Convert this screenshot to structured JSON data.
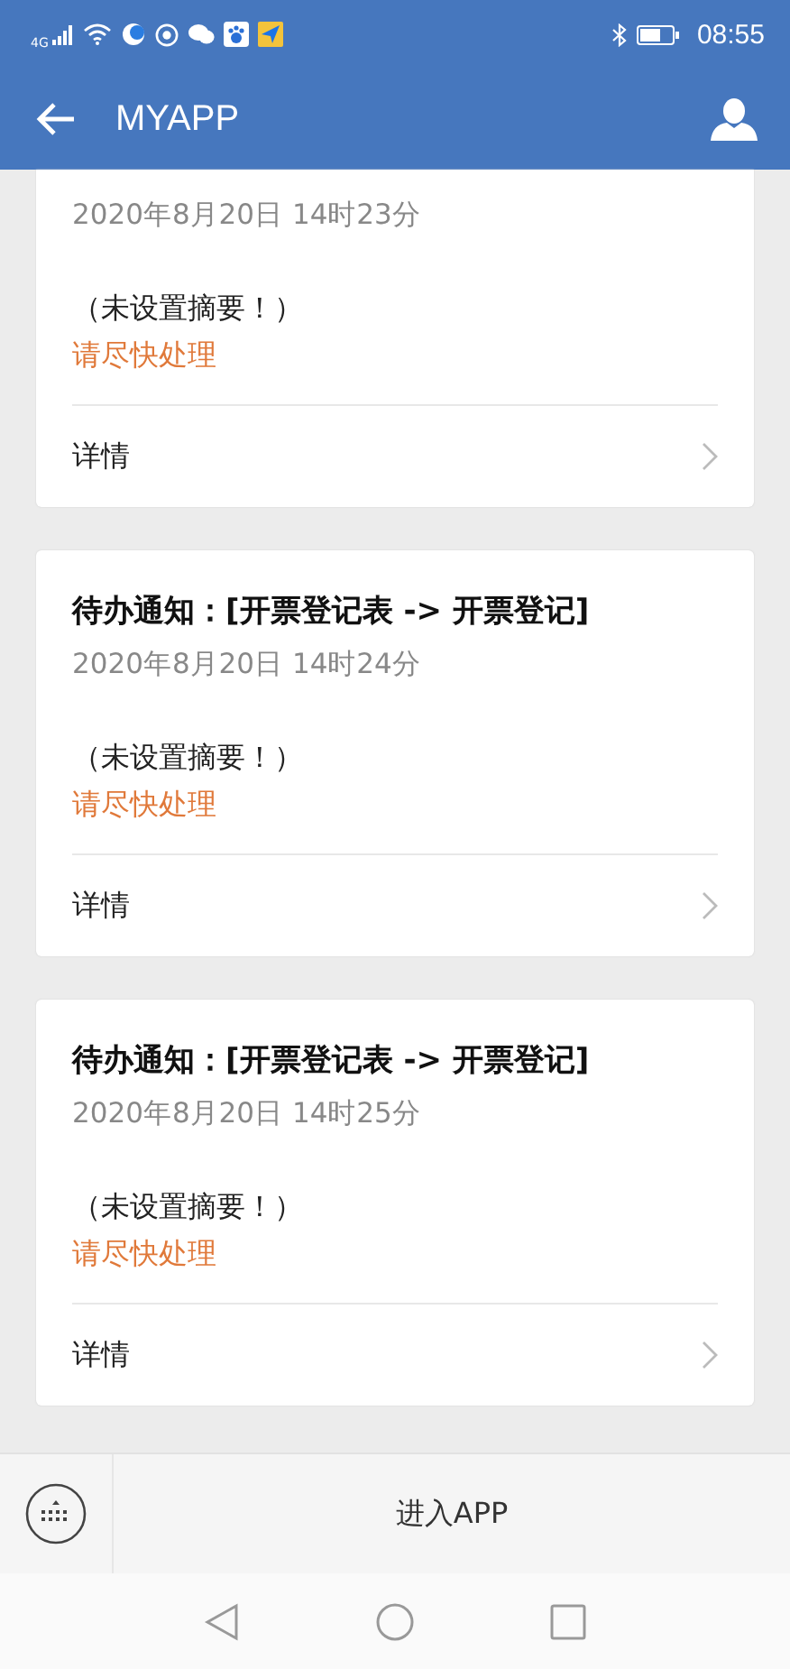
{
  "status_bar": {
    "network": "4G",
    "time": "08:55"
  },
  "header": {
    "title": "MYAPP"
  },
  "cards": [
    {
      "date": "2020年8月20日 14时23分",
      "summary": "（未设置摘要！）",
      "urgent": "请尽快处理",
      "detail": "详情"
    },
    {
      "title": "待办通知：[开票登记表 -> 开票登记]",
      "date": "2020年8月20日 14时24分",
      "summary": "（未设置摘要！）",
      "urgent": "请尽快处理",
      "detail": "详情"
    },
    {
      "title": "待办通知：[开票登记表 -> 开票登记]",
      "date": "2020年8月20日 14时25分",
      "summary": "（未设置摘要！）",
      "urgent": "请尽快处理",
      "detail": "详情"
    }
  ],
  "bottom_bar": {
    "label": "进入APP"
  }
}
